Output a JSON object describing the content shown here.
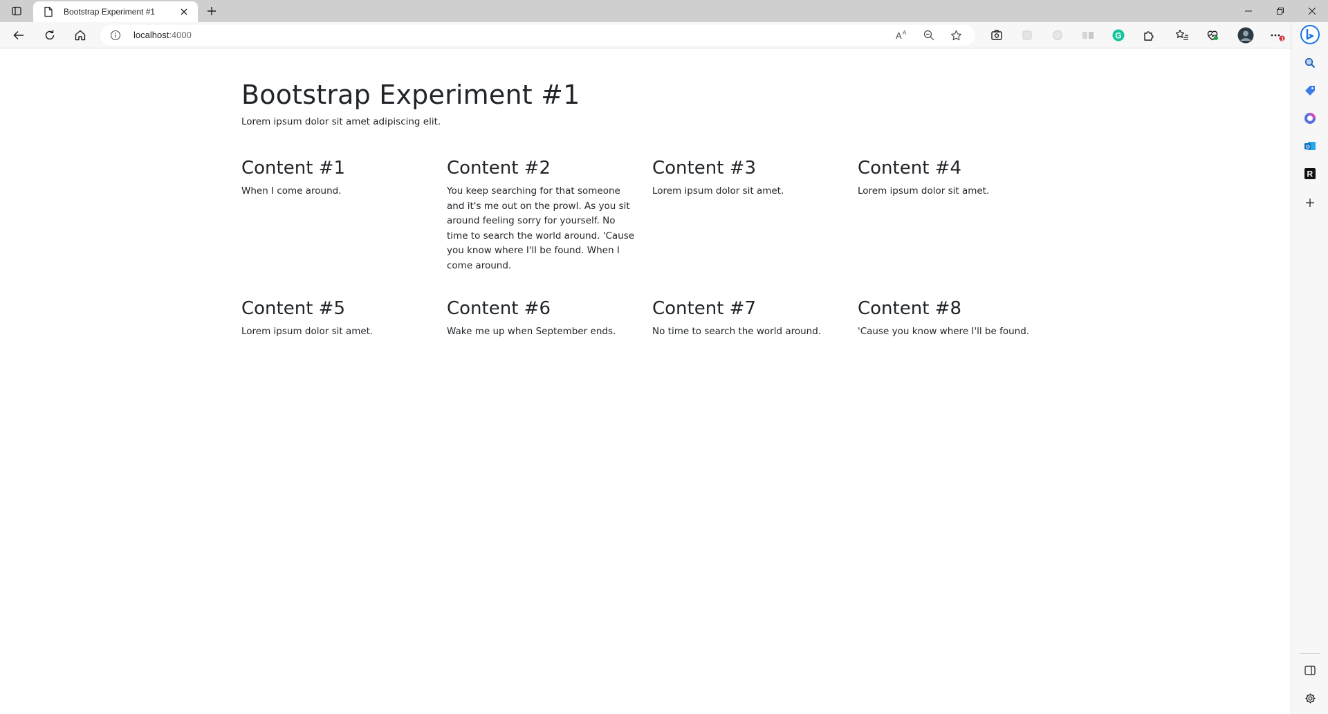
{
  "browser": {
    "tab": {
      "title": "Bootstrap Experiment #1"
    },
    "url": {
      "host": "localhost",
      "port": ":4000"
    }
  },
  "page": {
    "title": "Bootstrap Experiment #1",
    "lead": "Lorem ipsum dolor sit amet adipiscing elit.",
    "cards": [
      {
        "heading": "Content #1",
        "text": "When I come around."
      },
      {
        "heading": "Content #2",
        "text": "You keep searching for that someone and it's me out on the prowl. As you sit around feeling sorry for yourself. No time to search the world around. 'Cause you know where I'll be found. When I come around."
      },
      {
        "heading": "Content #3",
        "text": "Lorem ipsum dolor sit amet."
      },
      {
        "heading": "Content #4",
        "text": "Lorem ipsum dolor sit amet."
      },
      {
        "heading": "Content #5",
        "text": "Lorem ipsum dolor sit amet."
      },
      {
        "heading": "Content #6",
        "text": "Wake me up when September ends."
      },
      {
        "heading": "Content #7",
        "text": "No time to search the world around."
      },
      {
        "heading": "Content #8",
        "text": "'Cause you know where I'll be found."
      }
    ]
  },
  "colors": {
    "tabstrip": "#cfcfcf",
    "toolbar": "#f7f7f7",
    "text": "#212529",
    "grammarly": "#15c39a",
    "bing": "#1a73e8",
    "notification": "#d13438"
  },
  "icons": {
    "toolbar": [
      "read-aloud-icon",
      "zoom-out-icon",
      "favorite-star-icon",
      "screenshot-icon",
      "extension-icon",
      "grammarly-icon",
      "extensions-puzzle-icon",
      "favorites-icon",
      "performance-icon",
      "profile-avatar",
      "more-icon"
    ],
    "sidebar": [
      "bing-chat-icon",
      "search-icon",
      "shopping-icon",
      "office-icon",
      "outlook-icon",
      "reader-icon",
      "add-icon",
      "hide-sidebar-icon",
      "settings-icon"
    ]
  }
}
